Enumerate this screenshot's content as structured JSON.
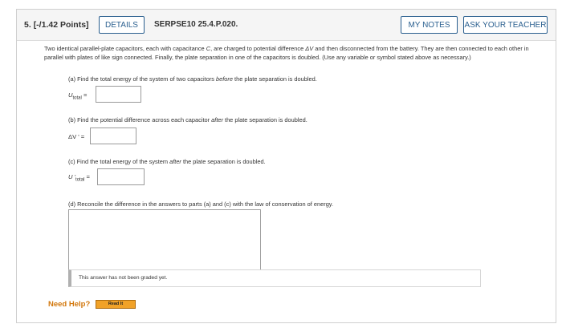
{
  "question": {
    "number": "5.",
    "points": "[-/1.42 Points]",
    "details_label": "DETAILS",
    "code": "SERPSE10 25.4.P.020.",
    "my_notes_label": "MY NOTES",
    "ask_teacher_label": "ASK YOUR TEACHER",
    "intro_a": "Two identical parallel-plate capacitors, each with capacitance ",
    "intro_C": "C",
    "intro_b": ", are charged to potential difference ",
    "intro_dV": "ΔV",
    "intro_c": " and then disconnected from the battery. They are then connected to each other in parallel with plates of like sign connected. Finally, the plate separation in one of the capacitors is doubled. (Use any variable or symbol stated above as necessary.)"
  },
  "parts": {
    "a_prefix": "(a) Find the total energy of the system of two capacitors ",
    "a_em": "before",
    "a_suffix": " the plate separation is doubled.",
    "a_var": "U",
    "a_sub": "total",
    "a_eq": " =",
    "b_prefix": "(b) Find the potential difference across each capacitor ",
    "b_em": "after",
    "b_suffix": " the plate separation is doubled.",
    "b_var": "ΔV ' =",
    "c_prefix": "(c) Find the total energy of the system ",
    "c_em": "after",
    "c_suffix": " the plate separation is doubled.",
    "c_var": "U '",
    "c_sub": "total",
    "c_eq": " =",
    "d_text": "(d) Reconcile the difference in the answers to parts (a) and (c) with the law of conservation of energy."
  },
  "status": {
    "not_graded": "This answer has not been graded yet."
  },
  "help": {
    "need_help": "Need Help?",
    "read_it": "Read It"
  }
}
